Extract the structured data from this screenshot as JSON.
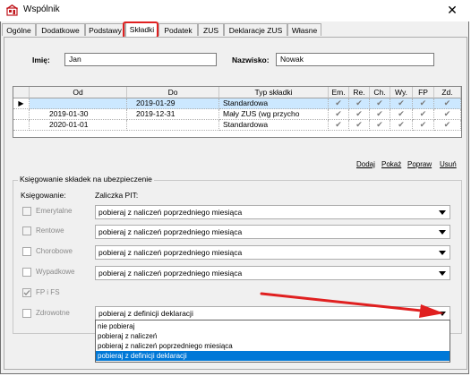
{
  "window": {
    "title": "Wspólnik",
    "close_glyph": "✕"
  },
  "tabs": [
    "Ogólne",
    "Dodatkowe",
    "Podstawy",
    "Składki",
    "Podatek",
    "ZUS",
    "Deklaracje ZUS",
    "Własne"
  ],
  "active_tab": "Składki",
  "form": {
    "first_name_label": "Imię:",
    "first_name_value": "Jan",
    "last_name_label": "Nazwisko:",
    "last_name_value": "Nowak"
  },
  "grid": {
    "columns": [
      "Od",
      "Do",
      "Typ składki",
      "Em.",
      "Re.",
      "Ch.",
      "Wy.",
      "FP",
      "Zd."
    ],
    "check_glyph": "✔",
    "current_row_glyph": "▶",
    "rows": [
      {
        "od": "",
        "do": "2019-01-29",
        "typ": "Standardowa"
      },
      {
        "od": "2019-01-30",
        "do": "2019-12-31",
        "typ": "Mały ZUS (wg przycho"
      },
      {
        "od": "2020-01-01",
        "do": "",
        "typ": "Standardowa"
      }
    ]
  },
  "actions": [
    "Dodaj",
    "Pokaż",
    "Popraw",
    "Usuń"
  ],
  "group": {
    "title": "Księgowanie składek na ubezpieczenie",
    "col1_header": "Księgowanie:",
    "col2_header": "Zaliczka PIT:",
    "items": [
      {
        "label": "Emerytalne",
        "value": "pobieraj z naliczeń poprzedniego miesiąca"
      },
      {
        "label": "Rentowe",
        "value": "pobieraj z naliczeń poprzedniego miesiąca"
      },
      {
        "label": "Chorobowe",
        "value": "pobieraj z naliczeń poprzedniego miesiąca"
      },
      {
        "label": "Wypadkowe",
        "value": "pobieraj z naliczeń poprzedniego miesiąca"
      },
      {
        "label": "FP i FS",
        "value": ""
      },
      {
        "label": "Zdrowotne",
        "value": "pobieraj z definicji deklaracji"
      }
    ]
  },
  "dropdown_options": [
    "nie pobieraj",
    "pobieraj z naliczeń",
    "pobieraj z naliczeń poprzedniego miesiąca",
    "pobieraj z definicji deklaracji"
  ],
  "dropdown_selected": "pobieraj z definicji deklaracji",
  "colors": {
    "highlight": "#e02020",
    "selection": "#0078d7",
    "row_selected": "#cce8ff"
  }
}
